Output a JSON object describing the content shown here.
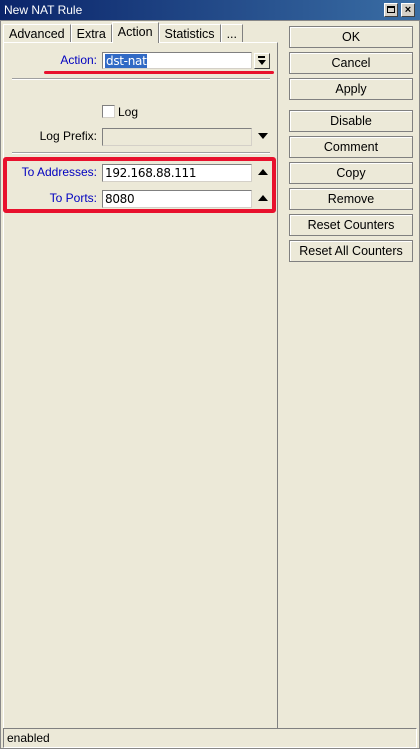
{
  "window": {
    "title": "New NAT Rule"
  },
  "tabs": [
    {
      "label": "Advanced"
    },
    {
      "label": "Extra"
    },
    {
      "label": "Action"
    },
    {
      "label": "Statistics"
    },
    {
      "label": "..."
    }
  ],
  "form": {
    "action": {
      "label": "Action:",
      "value": "dst-nat"
    },
    "log": {
      "label": "Log",
      "checked": false
    },
    "log_prefix": {
      "label": "Log Prefix:",
      "value": ""
    },
    "to_addresses": {
      "label": "To Addresses:",
      "value": "192.168.88.111"
    },
    "to_ports": {
      "label": "To Ports:",
      "value": "8080"
    }
  },
  "buttons": {
    "ok": "OK",
    "cancel": "Cancel",
    "apply": "Apply",
    "disable": "Disable",
    "comment": "Comment",
    "copy": "Copy",
    "remove": "Remove",
    "reset_counters": "Reset Counters",
    "reset_all_counters": "Reset All Counters"
  },
  "status": {
    "text": "enabled"
  },
  "colors": {
    "highlight": "#e8112d",
    "label_blue": "#0000c0",
    "selection": "#316ac5"
  }
}
